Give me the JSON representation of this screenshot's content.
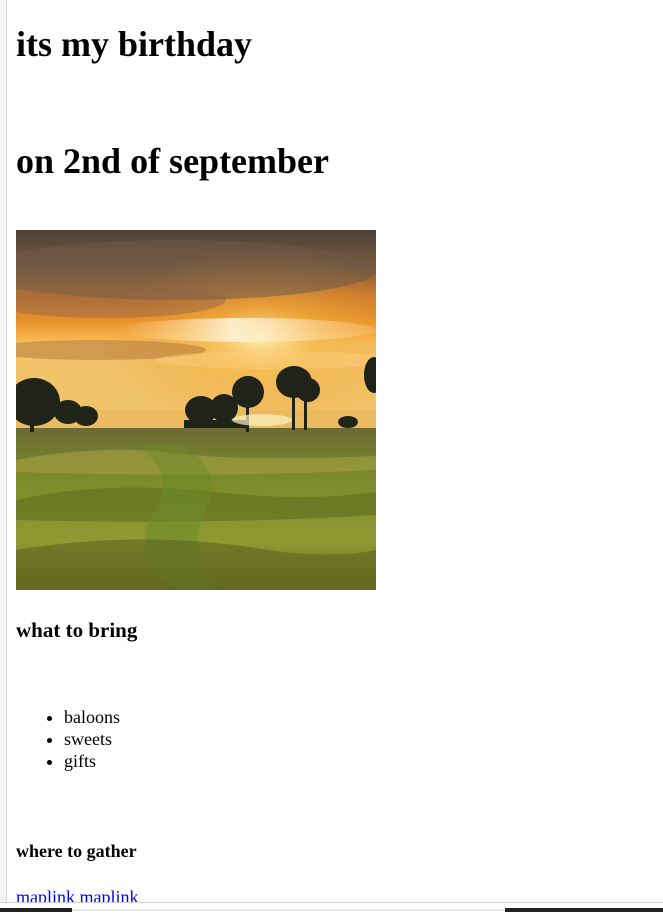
{
  "heading": {
    "title": "its my birthday",
    "subtitle": "on 2nd of september"
  },
  "image": {
    "icon": "sunset-field-photo",
    "colors": {
      "sky_top": "#5a4a3e",
      "sky_glow": "#f0a23a",
      "sun_core": "#ffe9a8",
      "field_dark": "#4f5a1d",
      "field_light": "#9da63a"
    }
  },
  "bring": {
    "heading": "what to bring",
    "items": [
      "baloons",
      "sweets",
      "gifts"
    ]
  },
  "gather": {
    "heading": "where to gather",
    "links": [
      "maplink",
      "maplink"
    ]
  },
  "colors": {
    "link": "#0000ee",
    "text": "#000000",
    "background": "#ffffff"
  }
}
